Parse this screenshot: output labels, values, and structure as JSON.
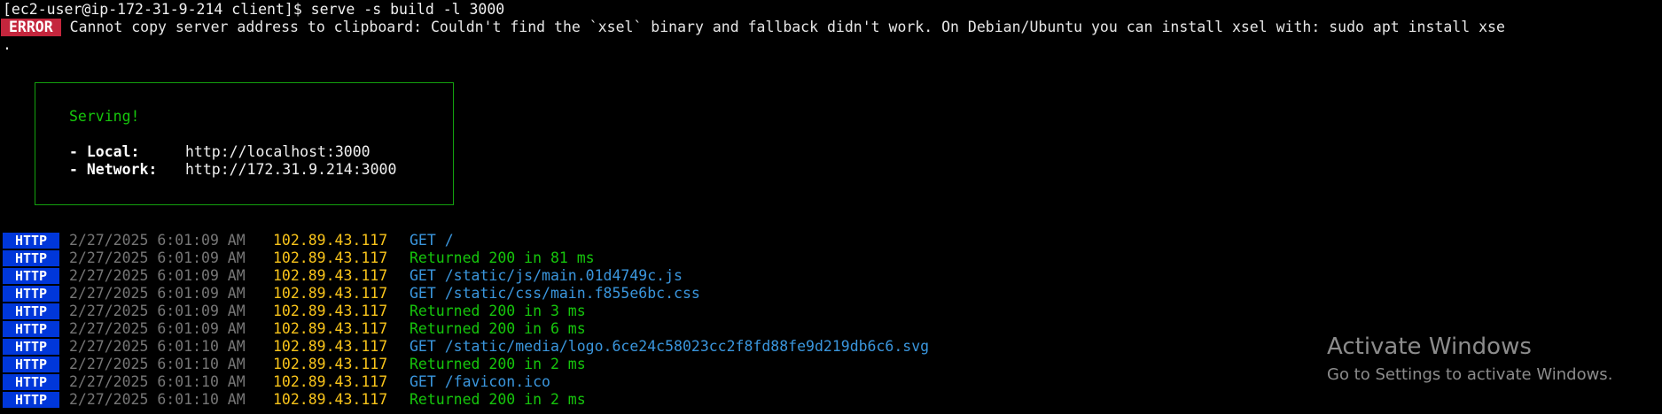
{
  "terminal": {
    "prompt": "[ec2-user@ip-172-31-9-214 client]$ serve -s build -l 3000",
    "error": {
      "badge": "ERROR",
      "message": "Cannot copy server address to clipboard: Couldn't find the `xsel` binary and fallback didn't work. On Debian/Ubuntu you can install xsel with: sudo apt install xse"
    },
    "continuation": ".",
    "serve_box": {
      "status": "Serving!",
      "local_label": "- Local:",
      "local_url": "http://localhost:3000",
      "network_label": "- Network:",
      "network_url": "http://172.31.9.214:3000"
    },
    "logs": [
      {
        "badge": "HTTP",
        "timestamp": "2/27/2025 6:01:09 AM",
        "ip": "102.89.43.117",
        "message": "GET /",
        "kind": "get"
      },
      {
        "badge": "HTTP",
        "timestamp": "2/27/2025 6:01:09 AM",
        "ip": "102.89.43.117",
        "message": "Returned 200 in 81 ms",
        "kind": "ret"
      },
      {
        "badge": "HTTP",
        "timestamp": "2/27/2025 6:01:09 AM",
        "ip": "102.89.43.117",
        "message": "GET /static/js/main.01d4749c.js",
        "kind": "get"
      },
      {
        "badge": "HTTP",
        "timestamp": "2/27/2025 6:01:09 AM",
        "ip": "102.89.43.117",
        "message": "GET /static/css/main.f855e6bc.css",
        "kind": "get"
      },
      {
        "badge": "HTTP",
        "timestamp": "2/27/2025 6:01:09 AM",
        "ip": "102.89.43.117",
        "message": "Returned 200 in 3 ms",
        "kind": "ret"
      },
      {
        "badge": "HTTP",
        "timestamp": "2/27/2025 6:01:09 AM",
        "ip": "102.89.43.117",
        "message": "Returned 200 in 6 ms",
        "kind": "ret"
      },
      {
        "badge": "HTTP",
        "timestamp": "2/27/2025 6:01:10 AM",
        "ip": "102.89.43.117",
        "message": "GET /static/media/logo.6ce24c58023cc2f8fd88fe9d219db6c6.svg",
        "kind": "get"
      },
      {
        "badge": "HTTP",
        "timestamp": "2/27/2025 6:01:10 AM",
        "ip": "102.89.43.117",
        "message": "Returned 200 in 2 ms",
        "kind": "ret"
      },
      {
        "badge": "HTTP",
        "timestamp": "2/27/2025 6:01:10 AM",
        "ip": "102.89.43.117",
        "message": "GET /favicon.ico",
        "kind": "get"
      },
      {
        "badge": "HTTP",
        "timestamp": "2/27/2025 6:01:10 AM",
        "ip": "102.89.43.117",
        "message": "Returned 200 in 2 ms",
        "kind": "ret"
      }
    ]
  },
  "watermark": {
    "title": "Activate Windows",
    "subtitle": "Go to Settings to activate Windows."
  },
  "colors": {
    "background": "#000000",
    "error_badge": "#c4263d",
    "http_badge": "#0037da",
    "ip": "#f9c41a",
    "get_message": "#3a96dd",
    "returned_message": "#16c60c",
    "timestamp": "#767676"
  }
}
